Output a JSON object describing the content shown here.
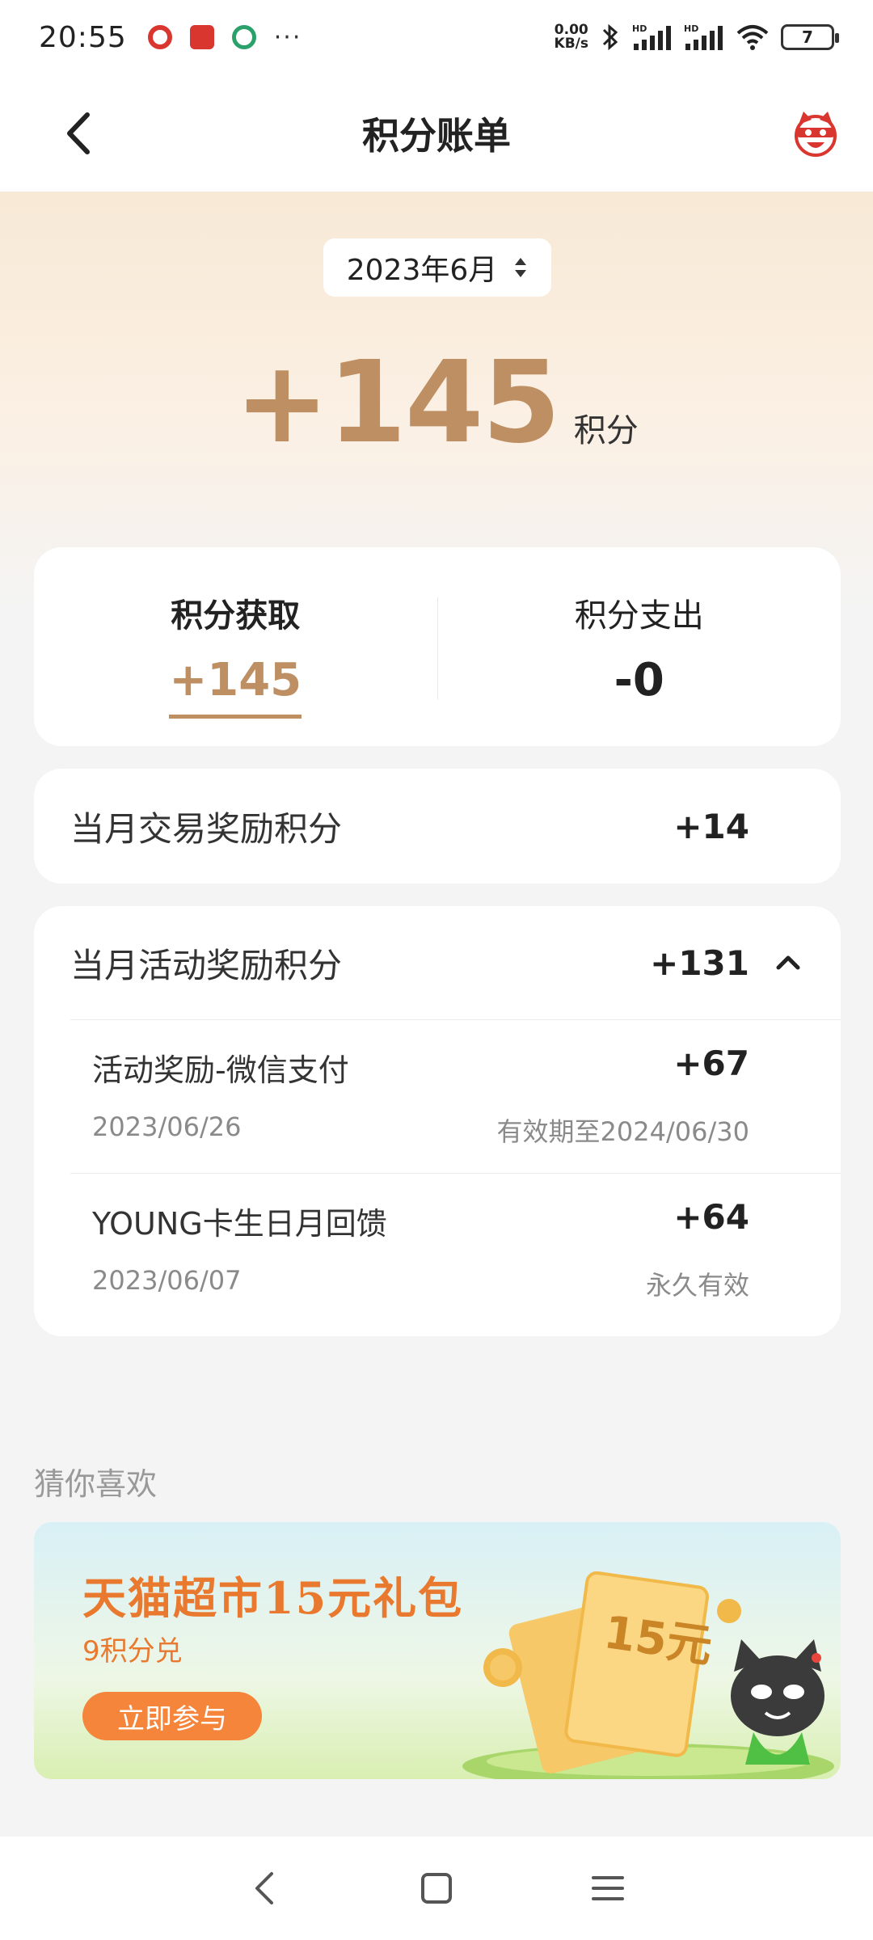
{
  "status_bar": {
    "time": "20:55",
    "net_speed_value": "0.00",
    "net_speed_unit": "KB/s",
    "more": "···",
    "battery": "7",
    "signal_1": "HD",
    "signal_2": "HD"
  },
  "nav": {
    "title": "积分账单"
  },
  "header": {
    "month": "2023年6月",
    "total": "+145",
    "unit": "积分"
  },
  "summary": {
    "earn_label": "积分获取",
    "earn_value": "+145",
    "spend_label": "积分支出",
    "spend_value": "-0"
  },
  "trade_reward": {
    "label": "当月交易奖励积分",
    "value": "+14"
  },
  "activity_reward": {
    "label": "当月活动奖励积分",
    "value": "+131",
    "items": [
      {
        "title": "活动奖励-微信支付",
        "value": "+67",
        "date": "2023/06/26",
        "expiry": "有效期至2024/06/30"
      },
      {
        "title": "YOUNG卡生日月回馈",
        "value": "+64",
        "date": "2023/06/07",
        "expiry": "永久有效"
      }
    ]
  },
  "recommend": {
    "title": "猜你喜欢",
    "banner_title": "天猫超市15元礼包",
    "banner_sub": "9积分兑",
    "banner_button": "立即参与",
    "coupon_text": "15元"
  },
  "colors": {
    "accent": "#bd8f62",
    "banner_orange": "#e8792e",
    "button_orange": "#f5853b"
  }
}
